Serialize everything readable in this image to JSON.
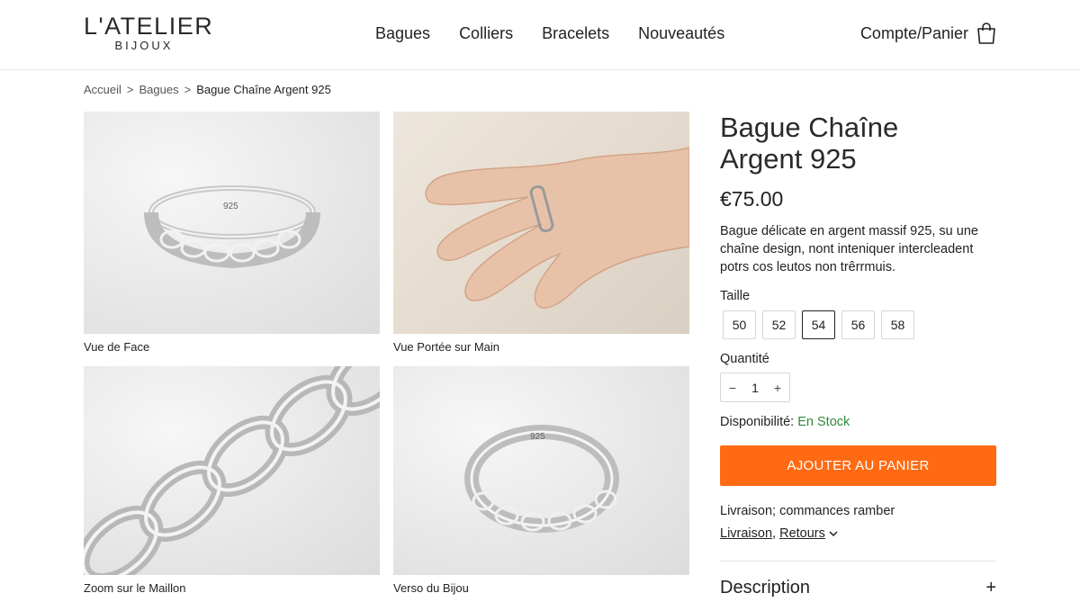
{
  "header": {
    "logo_main": "L'ATELIER",
    "logo_sub": "BIJOUX",
    "nav": [
      "Bagues",
      "Colliers",
      "Bracelets",
      "Nouveautés"
    ],
    "account_label": "Compte/Panier",
    "account_icon": "shopping-bag-icon"
  },
  "breadcrumb": {
    "items": [
      "Accueil",
      "Bagues"
    ],
    "separator": ">",
    "current": "Bague Chaîne Argent 925"
  },
  "gallery": [
    {
      "caption": "Vue de Face",
      "engraving": "925"
    },
    {
      "caption": "Vue Portée sur Main"
    },
    {
      "caption": "Zoom sur le Maillon"
    },
    {
      "caption": "Verso du Bijou",
      "engraving": "925"
    }
  ],
  "product": {
    "title_line1": "Bague Chaîne",
    "title_line2": "Argent 925",
    "price": "€75.00",
    "description": "Bague délicate en argent massif 925, su une chaîne design, nont inteniquer intercleadent potrs cos leutos non trêrrmuis.",
    "size_label": "Taille",
    "sizes": [
      "50",
      "52",
      "54",
      "56",
      "58"
    ],
    "selected_size": "54",
    "quantity_label": "Quantité",
    "quantity": "1",
    "minus": "−",
    "plus": "+",
    "availability_label": "Disponibilité:",
    "availability_value": "En Stock",
    "add_to_cart": "AJOUTER AU PANIER",
    "delivery_text": "Livraison; commances ramber",
    "link_delivery": "Livraison",
    "link_returns": "Retours",
    "section_title": "Description",
    "section_toggle": "+"
  },
  "colors": {
    "accent": "#ff6a13",
    "in_stock": "#2e8b3a"
  }
}
